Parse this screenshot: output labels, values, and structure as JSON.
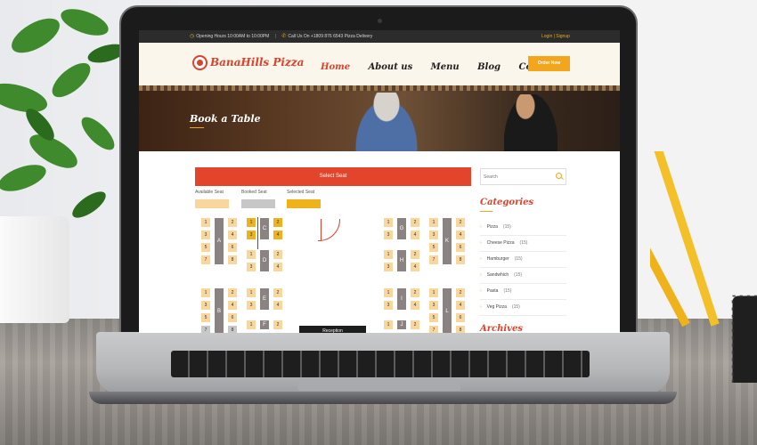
{
  "topbar": {
    "hours": "Opening Hours 10:00AM to 10:00PM",
    "call": "Call Us On +1809 876 6543 Pizza Delivery",
    "login": "Login | Signup"
  },
  "header": {
    "logo": "BanaHills Pizza",
    "nav": [
      "Home",
      "About us",
      "Menu",
      "Blog",
      "Contact"
    ],
    "order_button": "Order Now"
  },
  "banner": {
    "title": "Book a Table"
  },
  "booking": {
    "select_bar": "Select Seat",
    "legend": [
      "Available Seat",
      "Booked Seat",
      "Selected Seat"
    ],
    "reception": "Reception",
    "tables": [
      {
        "label": "A",
        "seats": [
          {
            "n": "1",
            "s": "av"
          },
          {
            "n": "2",
            "s": "av"
          },
          {
            "n": "3",
            "s": "av"
          },
          {
            "n": "4",
            "s": "av"
          },
          {
            "n": "5",
            "s": "av"
          },
          {
            "n": "6",
            "s": "av"
          },
          {
            "n": "7",
            "s": "av"
          },
          {
            "n": "8",
            "s": "av"
          }
        ]
      },
      {
        "label": "C",
        "seats": [
          {
            "n": "1",
            "s": "sel"
          },
          {
            "n": "2",
            "s": "sel"
          },
          {
            "n": "3",
            "s": "sel"
          },
          {
            "n": "4",
            "s": "sel"
          }
        ]
      },
      {
        "label": "D",
        "seats": [
          {
            "n": "1",
            "s": "av"
          },
          {
            "n": "2",
            "s": "av"
          },
          {
            "n": "3",
            "s": "av"
          },
          {
            "n": "4",
            "s": "av"
          }
        ]
      },
      {
        "label": "G",
        "seats": [
          {
            "n": "1",
            "s": "av"
          },
          {
            "n": "2",
            "s": "av"
          },
          {
            "n": "3",
            "s": "av"
          },
          {
            "n": "4",
            "s": "av"
          }
        ]
      },
      {
        "label": "H",
        "seats": [
          {
            "n": "1",
            "s": "av"
          },
          {
            "n": "2",
            "s": "av"
          },
          {
            "n": "3",
            "s": "av"
          },
          {
            "n": "4",
            "s": "av"
          }
        ]
      },
      {
        "label": "K",
        "seats": [
          {
            "n": "1",
            "s": "av"
          },
          {
            "n": "2",
            "s": "av"
          },
          {
            "n": "3",
            "s": "av"
          },
          {
            "n": "4",
            "s": "av"
          },
          {
            "n": "5",
            "s": "av"
          },
          {
            "n": "6",
            "s": "av"
          },
          {
            "n": "7",
            "s": "av"
          },
          {
            "n": "8",
            "s": "av"
          }
        ]
      },
      {
        "label": "B",
        "seats": [
          {
            "n": "1",
            "s": "av"
          },
          {
            "n": "2",
            "s": "av"
          },
          {
            "n": "3",
            "s": "av"
          },
          {
            "n": "4",
            "s": "av"
          },
          {
            "n": "5",
            "s": "av"
          },
          {
            "n": "6",
            "s": "av"
          },
          {
            "n": "7",
            "s": "bk"
          },
          {
            "n": "8",
            "s": "bk"
          }
        ]
      },
      {
        "label": "E",
        "seats": [
          {
            "n": "1",
            "s": "av"
          },
          {
            "n": "2",
            "s": "av"
          },
          {
            "n": "3",
            "s": "av"
          },
          {
            "n": "4",
            "s": "av"
          }
        ]
      },
      {
        "label": "F",
        "seats": [
          {
            "n": "1",
            "s": "av"
          },
          {
            "n": "2",
            "s": "av"
          }
        ]
      },
      {
        "label": "I",
        "seats": [
          {
            "n": "1",
            "s": "av"
          },
          {
            "n": "2",
            "s": "av"
          },
          {
            "n": "3",
            "s": "av"
          },
          {
            "n": "4",
            "s": "av"
          }
        ]
      },
      {
        "label": "J",
        "seats": [
          {
            "n": "1",
            "s": "av"
          },
          {
            "n": "2",
            "s": "av"
          }
        ]
      },
      {
        "label": "L",
        "seats": [
          {
            "n": "1",
            "s": "av"
          },
          {
            "n": "2",
            "s": "av"
          },
          {
            "n": "3",
            "s": "av"
          },
          {
            "n": "4",
            "s": "av"
          },
          {
            "n": "5",
            "s": "av"
          },
          {
            "n": "6",
            "s": "av"
          },
          {
            "n": "7",
            "s": "av"
          },
          {
            "n": "8",
            "s": "av"
          }
        ]
      }
    ]
  },
  "sidebar": {
    "search_placeholder": "Search",
    "categories_title": "Categories",
    "categories": [
      {
        "name": "Pizza",
        "count": "(15)"
      },
      {
        "name": "Cheese Pizza",
        "count": "(15)"
      },
      {
        "name": "Hamburger",
        "count": "(15)"
      },
      {
        "name": "Sandwhich",
        "count": "(15)"
      },
      {
        "name": "Pasta",
        "count": "(15)"
      },
      {
        "name": "Veg Pizza",
        "count": "(15)"
      }
    ],
    "archives_title": "Archives"
  },
  "colors": {
    "brand_red": "#e2452b",
    "accent_orange": "#f3a51c",
    "available": "#f9d79c",
    "booked": "#c7c7c7",
    "selected": "#f0b21b"
  },
  "icons": [
    "clock-icon",
    "phone-icon",
    "search-icon",
    "chevron-right-icon"
  ]
}
